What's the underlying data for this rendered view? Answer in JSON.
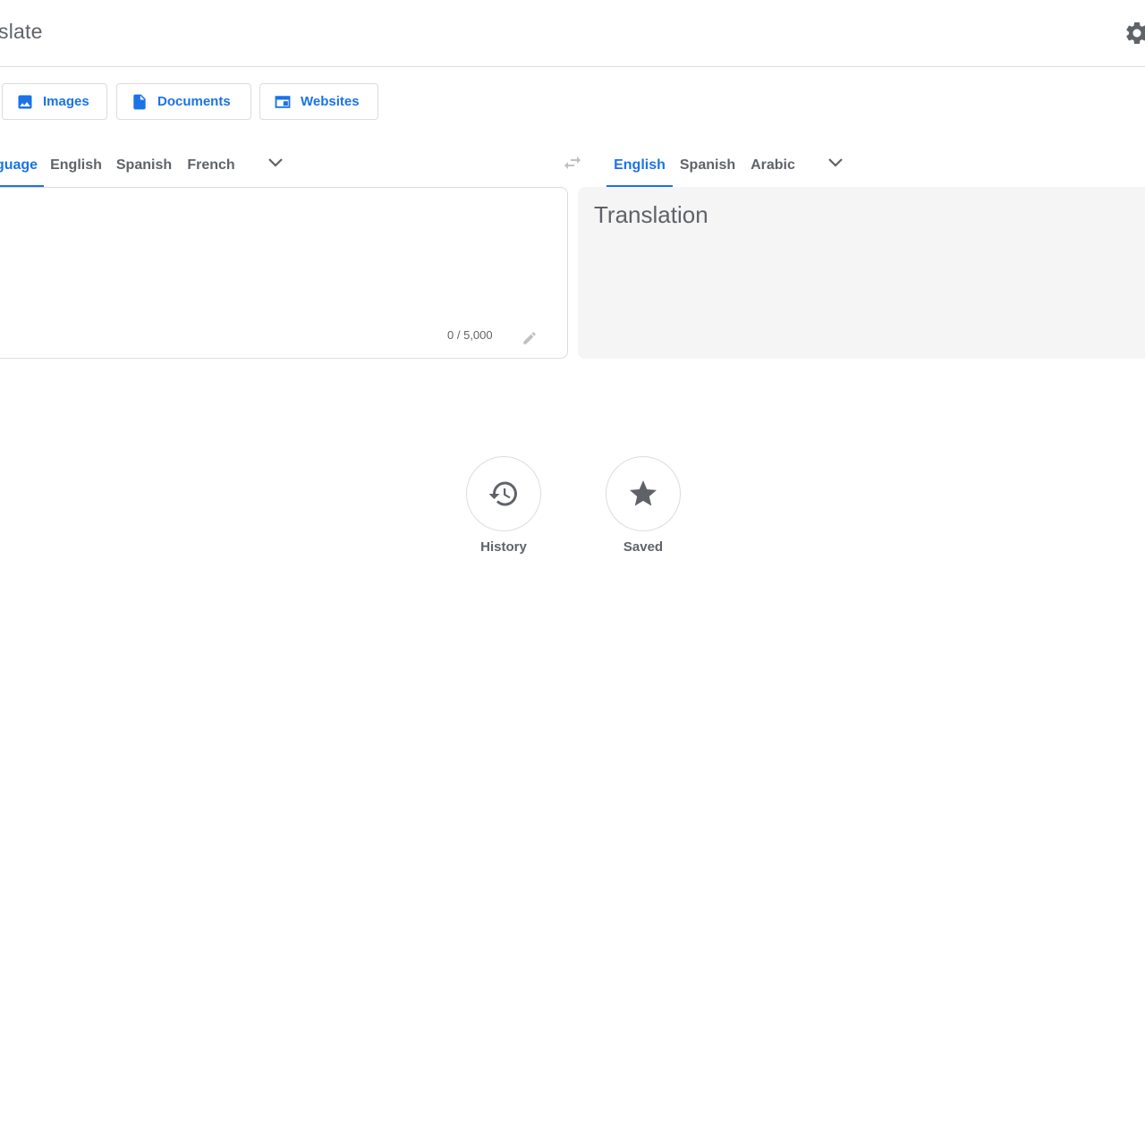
{
  "header": {
    "title": "slate",
    "settings_icon": "gear-icon"
  },
  "modes": [
    {
      "label": "Images",
      "icon": "image-icon"
    },
    {
      "label": "Documents",
      "icon": "document-icon"
    },
    {
      "label": "Websites",
      "icon": "website-icon"
    }
  ],
  "source_languages": [
    {
      "label": "guage",
      "active": true
    },
    {
      "label": "English",
      "active": false
    },
    {
      "label": "Spanish",
      "active": false
    },
    {
      "label": "French",
      "active": false
    }
  ],
  "target_languages": [
    {
      "label": "English",
      "active": true
    },
    {
      "label": "Spanish",
      "active": false
    },
    {
      "label": "Arabic",
      "active": false
    }
  ],
  "source": {
    "value": "",
    "char_count": "0 / 5,000"
  },
  "target": {
    "placeholder": "Translation"
  },
  "shortcuts": [
    {
      "label": "History",
      "icon": "history-icon"
    },
    {
      "label": "Saved",
      "icon": "star-icon"
    }
  ],
  "colors": {
    "accent": "#1a73e8",
    "text_secondary": "#5f6368",
    "border": "#dadce0",
    "target_bg": "#f5f5f5"
  }
}
